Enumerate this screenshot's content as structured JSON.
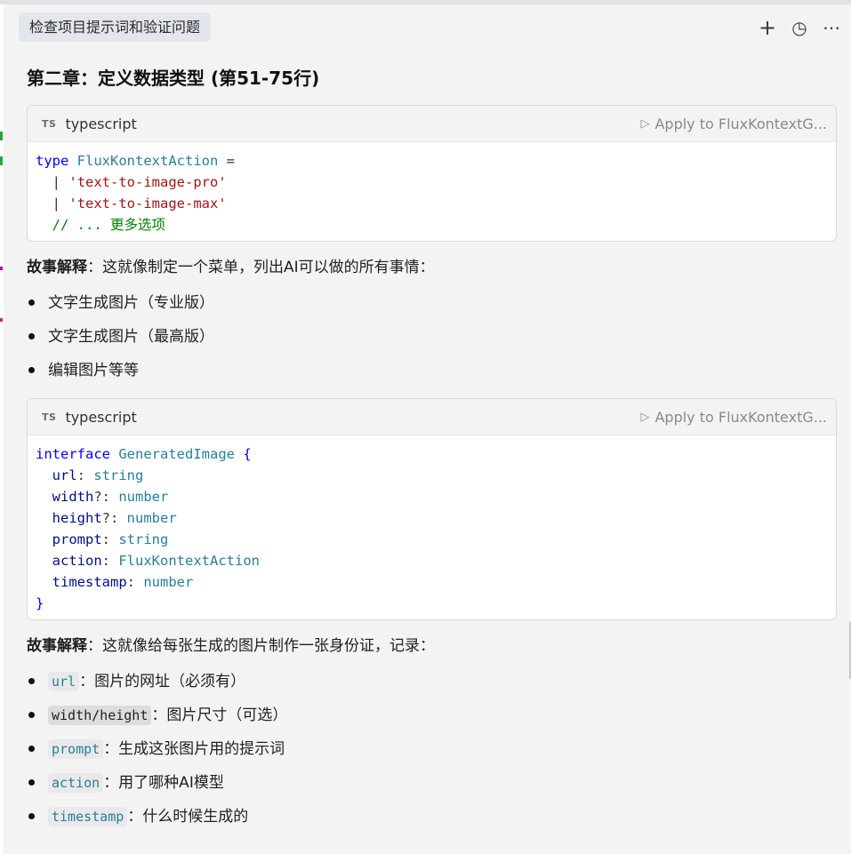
{
  "header": {
    "tab_title": "检查项目提示词和验证问题",
    "icons": [
      "plus-icon",
      "history-icon",
      "more-icon"
    ],
    "plus_glyph": "+",
    "history_glyph": "◷",
    "more_glyph": "⋯"
  },
  "section": {
    "heading": "第二章：定义数据类型 (第51-75行)"
  },
  "code1": {
    "badge": "TS",
    "language": "typescript",
    "apply_label": "Apply to FluxKontextG...",
    "apply_glyph": "▷",
    "line1_kw": "type",
    "line1_name": "FluxKontextAction",
    "line1_eq": " =",
    "pipe": "|",
    "line2_str": "'text-to-image-pro'",
    "line3_str": "'text-to-image-max'",
    "line4_comment": "// ... 更多选项"
  },
  "story1": {
    "label": "故事解释",
    "text": "：这就像制定一个菜单，列出AI可以做的所有事情：",
    "items": [
      "文字生成图片（专业版）",
      "文字生成图片（最高版）",
      "编辑图片等等"
    ]
  },
  "code2": {
    "badge": "TS",
    "language": "typescript",
    "apply_label": "Apply to FluxKontextG...",
    "apply_glyph": "▷",
    "kw": "interface",
    "name": "GeneratedImage",
    "open": "{",
    "close": "}",
    "fields": [
      {
        "name": "url",
        "sep": ": ",
        "type": "string"
      },
      {
        "name": "width",
        "sep": "?: ",
        "type": "number"
      },
      {
        "name": "height",
        "sep": "?: ",
        "type": "number"
      },
      {
        "name": "prompt",
        "sep": ": ",
        "type": "string"
      },
      {
        "name": "action",
        "sep": ": ",
        "type": "FluxKontextAction"
      },
      {
        "name": "timestamp",
        "sep": ": ",
        "type": "number"
      }
    ]
  },
  "story2": {
    "label": "故事解释",
    "text": "：这就像给每张生成的图片制作一张身份证，记录：",
    "items": [
      {
        "code": "url",
        "text": "：图片的网址（必须有）"
      },
      {
        "code": "width/height",
        "text": "：图片尺寸（可选）"
      },
      {
        "code": "prompt",
        "text": "：生成这张图片用的提示词"
      },
      {
        "code": "action",
        "text": "：用了哪种AI模型"
      },
      {
        "code": "timestamp",
        "text": "：什么时候生成的"
      }
    ]
  },
  "colors": {
    "keyword": "#0000ff",
    "type": "#267f99",
    "string": "#a31515",
    "comment": "#008000",
    "identifier": "#001080"
  }
}
